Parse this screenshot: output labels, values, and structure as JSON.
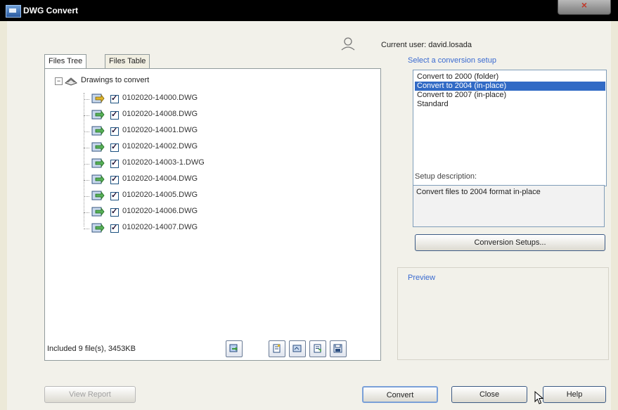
{
  "window": {
    "title": "DWG Convert",
    "app_icon": "dwg-convert-app-icon"
  },
  "user": {
    "label": "Current user: david.losada",
    "icon": "user-icon"
  },
  "tabs": [
    {
      "label": "Files Tree",
      "active": true
    },
    {
      "label": "Files Table",
      "active": false
    }
  ],
  "tree": {
    "root_label": "Drawings to convert",
    "files": [
      {
        "name": "0102020-14000.DWG",
        "checked": true
      },
      {
        "name": "0102020-14008.DWG",
        "checked": true
      },
      {
        "name": "0102020-14001.DWG",
        "checked": true
      },
      {
        "name": "0102020-14002.DWG",
        "checked": true
      },
      {
        "name": "0102020-14003-1.DWG",
        "checked": true
      },
      {
        "name": "0102020-14004.DWG",
        "checked": true
      },
      {
        "name": "0102020-14005.DWG",
        "checked": true
      },
      {
        "name": "0102020-14006.DWG",
        "checked": true
      },
      {
        "name": "0102020-14007.DWG",
        "checked": true
      }
    ]
  },
  "status": {
    "included_text": "Included 9 file(s), 3453KB"
  },
  "toolbar": {
    "buttons": [
      "add-files-icon",
      "file-properties-icon",
      "open-drawing-icon",
      "report-list-icon",
      "save-list-icon"
    ]
  },
  "conversion": {
    "select_label": "Select a conversion setup",
    "setups": [
      {
        "label": "Convert to 2000 (folder)",
        "selected": false
      },
      {
        "label": "Convert to 2004 (in-place)",
        "selected": true
      },
      {
        "label": "Convert to 2007 (in-place)",
        "selected": false
      },
      {
        "label": "Standard",
        "selected": false
      }
    ],
    "description_label": "Setup description:",
    "description_text": "Convert files to 2004 format in-place",
    "setups_button": "Conversion Setups..."
  },
  "preview": {
    "label": "Preview"
  },
  "buttons": {
    "view_report": "View Report",
    "convert": "Convert",
    "close": "Close",
    "help": "Help"
  },
  "colors": {
    "selection": "#316ac5",
    "accent_label": "#3a6ad0",
    "titlebar": "#000000"
  }
}
